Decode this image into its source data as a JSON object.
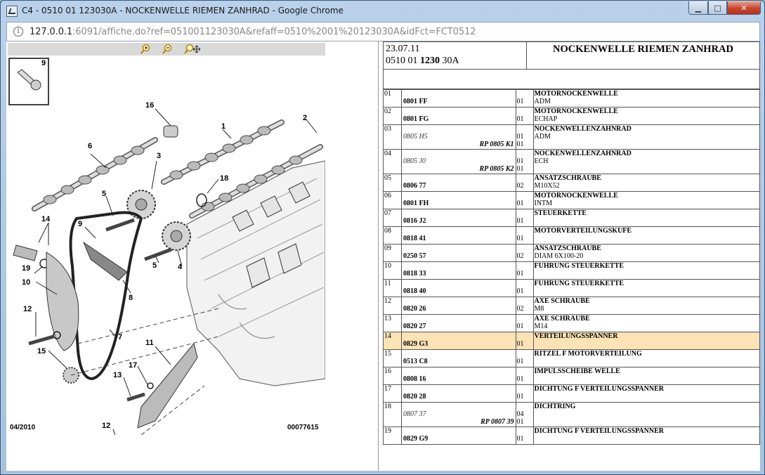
{
  "window": {
    "title": "C4 - 0510 01 123030A - NOCKENWELLE RIEMEN ZANHRAD - Google Chrome",
    "minimize": "▁",
    "maximize": "□",
    "close": "✕"
  },
  "address": {
    "host": "127.0.0.1",
    "rest": ":6091/affiche.do?ref=051001123030A&refaff=0510%2001%20123030A&idFct=FCT0512"
  },
  "toolbar": {
    "zoom_in_icon": "zoom-in-icon",
    "zoom_out_icon": "zoom-out-icon",
    "pan_icon": "pan-icon"
  },
  "diagram": {
    "callouts": [
      "9",
      "16",
      "1",
      "2",
      "6",
      "3",
      "18",
      "5",
      "14",
      "9",
      "19",
      "10",
      "5",
      "4",
      "8",
      "12",
      "7",
      "15",
      "11",
      "17",
      "13",
      "12"
    ],
    "date": "04/2010",
    "ref": "00077615"
  },
  "header": {
    "date": "23.07.11",
    "code_prefix": "0510 01 ",
    "code_bold": "1230",
    "code_suffix": " 30A",
    "title": "NOCKENWELLE RIEMEN ZANHRAD"
  },
  "parts": [
    {
      "idx": "01",
      "ref": "0801 FF",
      "qty": "01",
      "name": "MOTORNOCKENWELLE",
      "sub": "ADM"
    },
    {
      "idx": "02",
      "ref": "0801 FG",
      "qty": "01",
      "name": "MOTORNOCKENWELLE",
      "sub": "ECHAP"
    },
    {
      "idx": "03",
      "ref": "0805 H5",
      "rp": "RP 0805 K1",
      "qty": "01",
      "qty2": "01",
      "name": "NOCKENWELLENZAHNRAD",
      "sub": "ADM",
      "italic": true
    },
    {
      "idx": "04",
      "ref": "0805 J0",
      "rp": "RP 0805 K2",
      "qty": "01",
      "qty2": "01",
      "name": "NOCKENWELLENZAHNRAD",
      "sub": "ECH",
      "italic": true
    },
    {
      "idx": "05",
      "ref": "0806 77",
      "qty": "02",
      "name": "ANSATZSCHRAUBE",
      "sub": "M10X52"
    },
    {
      "idx": "06",
      "ref": "0801 FH",
      "qty": "01",
      "name": "MOTORNOCKENWELLE",
      "sub": "INTM"
    },
    {
      "idx": "07",
      "ref": "0816 J2",
      "qty": "01",
      "name": "STEUERKETTE",
      "sub": ""
    },
    {
      "idx": "08",
      "ref": "0818 41",
      "qty": "01",
      "name": "MOTORVERTEILUNGSKUFE",
      "sub": ""
    },
    {
      "idx": "09",
      "ref": "0250 57",
      "qty": "02",
      "name": "ANSATZSCHRAUBE",
      "sub": "DIAM 6X100-20"
    },
    {
      "idx": "10",
      "ref": "0818 33",
      "qty": "01",
      "name": "FUHRUNG STEUERKETTE",
      "sub": ""
    },
    {
      "idx": "11",
      "ref": "0818 40",
      "qty": "01",
      "name": "FUHRUNG STEUERKETTE",
      "sub": ""
    },
    {
      "idx": "12",
      "ref": "0820 26",
      "qty": "02",
      "name": "AXE SCHRAUBE",
      "sub": "M8"
    },
    {
      "idx": "13",
      "ref": "0820 27",
      "qty": "01",
      "name": "AXE SCHRAUBE",
      "sub": "M14"
    },
    {
      "idx": "14",
      "ref": "0829 G3",
      "qty": "01",
      "name": "VERTEILUNGSSPANNER",
      "sub": "",
      "highlight": true
    },
    {
      "idx": "15",
      "ref": "0513 C8",
      "qty": "01",
      "name": "RITZEL F MOTORVERTEILUNG",
      "sub": ""
    },
    {
      "idx": "16",
      "ref": "0808 16",
      "qty": "01",
      "name": "IMPULSSCHEIBE WELLE",
      "sub": ""
    },
    {
      "idx": "17",
      "ref": "0820 28",
      "qty": "01",
      "name": "DICHTUNG F VERTEILUNGSSPANNER",
      "sub": ""
    },
    {
      "idx": "18",
      "ref": "0807 37",
      "rp": "RP 0807 39",
      "qty": "04",
      "qty2": "01",
      "name": "DICHTRING",
      "sub": "",
      "italic": true
    },
    {
      "idx": "19",
      "ref": "0829 G9",
      "qty": "01",
      "name": "DICHTUNG F VERTEILUNGSSPANNER",
      "sub": ""
    }
  ],
  "colors": {
    "highlight": "#fbe3b6",
    "zoom_icons": "#c99700"
  }
}
